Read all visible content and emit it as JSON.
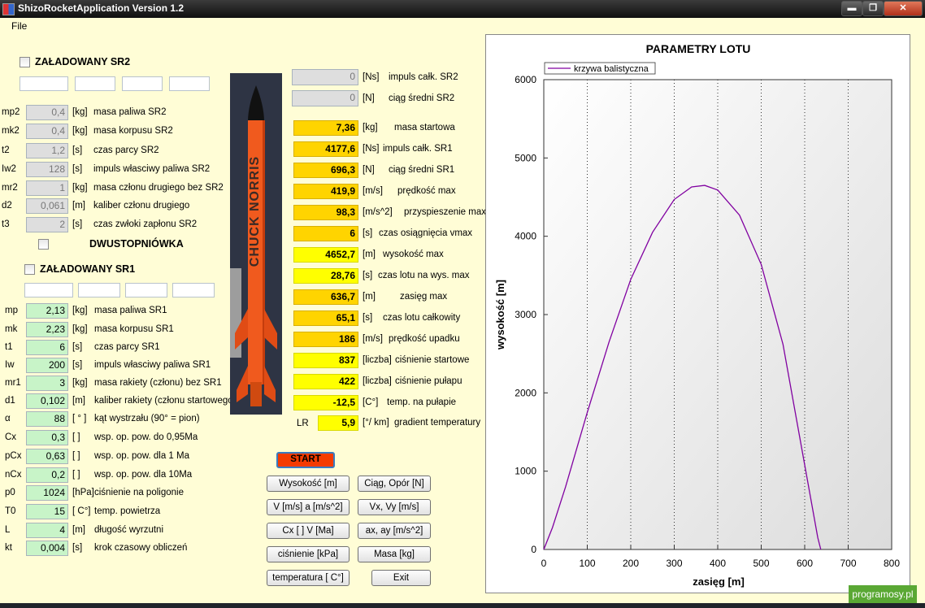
{
  "window": {
    "title": "ShizoRocketApplication    Version 1.2",
    "min": "▬",
    "max": "❐",
    "close": "✕"
  },
  "menu": {
    "file": "File"
  },
  "sr2": {
    "header": "ZAŁADOWANY SR2",
    "rows": [
      {
        "code": "mp2",
        "value": "0,4",
        "unit": "[kg]",
        "desc": "masa paliwa SR2"
      },
      {
        "code": "mk2",
        "value": "0,4",
        "unit": "[kg]",
        "desc": "masa korpusu SR2"
      },
      {
        "code": "t2",
        "value": "1,2",
        "unit": "[s]",
        "desc": "czas parcy SR2"
      },
      {
        "code": "Iw2",
        "value": "128",
        "unit": "[s]",
        "desc": "impuls własciwy paliwa SR2"
      },
      {
        "code": "mr2",
        "value": "1",
        "unit": "[kg]",
        "desc": "masa członu drugiego bez SR2"
      },
      {
        "code": "d2",
        "value": "0,061",
        "unit": "[m]",
        "desc": "kaliber członu drugiego"
      },
      {
        "code": "t3",
        "value": "2",
        "unit": "[s]",
        "desc": "czas zwłoki zapłonu SR2"
      }
    ]
  },
  "dwu": {
    "label": "DWUSTOPNIÓWKA"
  },
  "sr1": {
    "header": "ZAŁADOWANY SR1",
    "rows": [
      {
        "code": "mp",
        "value": "2,13",
        "unit": "[kg]",
        "desc": "masa paliwa SR1"
      },
      {
        "code": "mk",
        "value": "2,23",
        "unit": "[kg]",
        "desc": "masa korpusu SR1"
      },
      {
        "code": "t1",
        "value": "6",
        "unit": "[s]",
        "desc": "czas parcy SR1"
      },
      {
        "code": "Iw",
        "value": "200",
        "unit": "[s]",
        "desc": "impuls własciwy paliwa SR1"
      },
      {
        "code": "mr1",
        "value": "3",
        "unit": "[kg]",
        "desc": "masa rakiety (członu) bez SR1"
      },
      {
        "code": "d1",
        "value": "0,102",
        "unit": "[m]",
        "desc": "kaliber rakiety (członu startowego)"
      },
      {
        "code": "α",
        "value": "88",
        "unit": "[ ° ]",
        "desc": "kąt wystrzału (90° = pion)"
      },
      {
        "code": "Cx",
        "value": "0,3",
        "unit": "[ ]",
        "desc": "wsp. op. pow. do    0,95Ma"
      },
      {
        "code": "pCx",
        "value": "0,63",
        "unit": "[ ]",
        "desc": "wsp. op. pow. dla   1  Ma"
      },
      {
        "code": "nCx",
        "value": "0,2",
        "unit": "[ ]",
        "desc": "wsp. op. pow. dla 10Ma"
      },
      {
        "code": "p0",
        "value": "1024",
        "unit": "[hPa]",
        "desc": "ciśnienie na poligonie"
      },
      {
        "code": "T0",
        "value": "15",
        "unit": "[ C°]",
        "desc": "temp. powietrza"
      },
      {
        "code": "L",
        "value": "4",
        "unit": "[m]",
        "desc": "długość wyrzutni"
      },
      {
        "code": "kt",
        "value": "0,004",
        "unit": "[s]",
        "desc": "krok czasowy obliczeń"
      }
    ]
  },
  "rocket": {
    "text": "CHUCK NORRIS"
  },
  "results": {
    "gray": [
      {
        "value": "0",
        "unit": "[Ns]",
        "desc": "impuls całk. SR2"
      },
      {
        "value": "0",
        "unit": "[N]",
        "desc": "ciąg średni SR2"
      }
    ],
    "rows": [
      {
        "value": "7,36",
        "unit": "[kg]",
        "desc": "masa startowa",
        "style": "orange"
      },
      {
        "value": "4177,6",
        "unit": "[Ns]",
        "desc": "impuls całk. SR1",
        "style": "orange"
      },
      {
        "value": "696,3",
        "unit": "[N]",
        "desc": "ciąg średni SR1",
        "style": "orange"
      },
      {
        "value": "419,9",
        "unit": "[m/s]",
        "desc": "prędkość max",
        "style": "orange"
      },
      {
        "value": "98,3",
        "unit": "[m/s^2]",
        "desc": "przyspieszenie max",
        "style": "orange"
      },
      {
        "value": "6",
        "unit": "[s]",
        "desc": "czas osiągnięcia vmax",
        "style": "orange"
      },
      {
        "value": "4652,7",
        "unit": "[m]",
        "desc": "wysokość max",
        "style": "yellow"
      },
      {
        "value": "28,76",
        "unit": "[s]",
        "desc": "czas lotu na wys. max",
        "style": "yellow"
      },
      {
        "value": "636,7",
        "unit": "[m]",
        "desc": "zasięg max",
        "style": "orange"
      },
      {
        "value": "65,1",
        "unit": "[s]",
        "desc": "czas lotu całkowity",
        "style": "orange"
      },
      {
        "value": "186",
        "unit": "[m/s]",
        "desc": "prędkość upadku",
        "style": "orange"
      },
      {
        "value": "837",
        "unit": "[liczba]",
        "desc": "ciśnienie startowe",
        "style": "yellow"
      },
      {
        "value": "422",
        "unit": "[liczba]",
        "desc": "ciśnienie pułapu",
        "style": "yellow"
      },
      {
        "value": "-12,5",
        "unit": "[C°]",
        "desc": "temp. na pułapie",
        "style": "yellow"
      }
    ],
    "lr": {
      "code": "LR",
      "value": "5,9",
      "unit": "[°/ km]",
      "desc": "gradient temperatury"
    }
  },
  "buttons": {
    "start": "START",
    "wysokosc": "Wysokość  [m]",
    "ciag": "Ciąg, Opór [N]",
    "va": "V [m/s]  a [m/s^2]",
    "vxvy": "Vx, Vy [m/s]",
    "cxv": "Cx [ ]   V [Ma]",
    "axay": "ax, ay [m/s^2]",
    "cisnienie": "ciśnienie [kPa]",
    "masa": "Masa [kg]",
    "temperatura": "temperatura [ C°]",
    "exit": "Exit"
  },
  "chart_data": {
    "type": "line",
    "title": "PARAMETRY LOTU",
    "xlabel": "zasięg [m]",
    "ylabel": "wysokość [m]",
    "xlim": [
      0,
      800
    ],
    "ylim": [
      0,
      6000
    ],
    "xticks": [
      0,
      100,
      200,
      300,
      400,
      500,
      600,
      700,
      800
    ],
    "yticks": [
      0,
      1000,
      2000,
      3000,
      4000,
      5000,
      6000
    ],
    "grid": "vertical dotted",
    "legend": "top-left",
    "series": [
      {
        "name": "krzywa balistyczna",
        "color": "#8000a0",
        "x": [
          0,
          20,
          50,
          100,
          150,
          200,
          250,
          300,
          340,
          370,
          400,
          450,
          500,
          550,
          600,
          630,
          637
        ],
        "y": [
          0,
          280,
          800,
          1750,
          2650,
          3450,
          4050,
          4470,
          4630,
          4650,
          4590,
          4270,
          3640,
          2620,
          1080,
          150,
          0
        ]
      }
    ]
  },
  "watermark": "programosy.pl"
}
